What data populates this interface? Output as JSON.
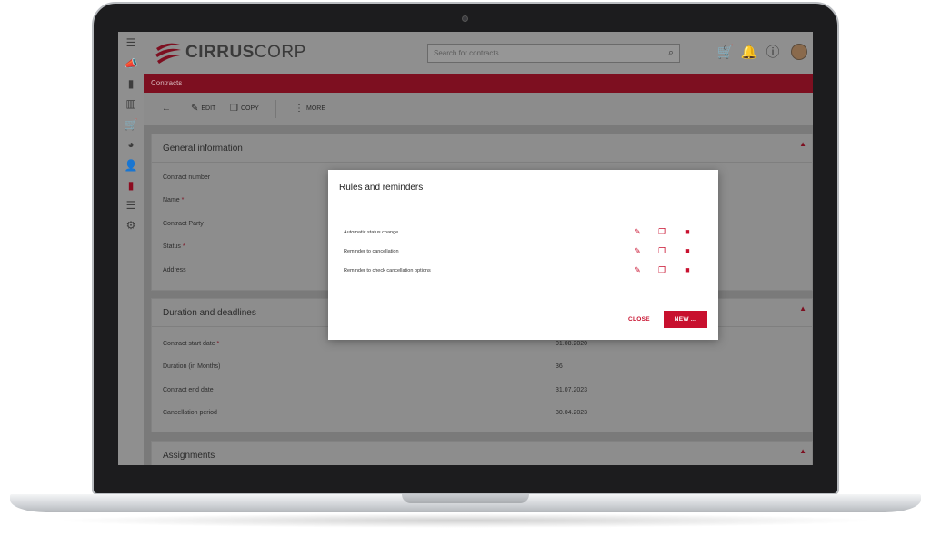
{
  "app": {
    "brand_bold": "CIRRUS",
    "brand_light": "CORP",
    "brand_color": "#c8102e"
  },
  "sidebar": {
    "items": [
      {
        "icon": "menu-icon"
      },
      {
        "icon": "megaphone-icon"
      },
      {
        "icon": "contract-doc-icon"
      },
      {
        "icon": "book-icon"
      },
      {
        "icon": "cart-icon"
      },
      {
        "icon": "pie-chart-icon"
      },
      {
        "icon": "person-icon"
      },
      {
        "icon": "contract-active-icon"
      },
      {
        "icon": "database-icon"
      },
      {
        "icon": "gear-icon"
      }
    ]
  },
  "search": {
    "placeholder": "Search for contracts..."
  },
  "header": {
    "cart_count": "0"
  },
  "breadcrumb": {
    "label": "Contracts"
  },
  "toolbar": {
    "edit_label": "EDIT",
    "copy_label": "COPY",
    "more_label": "MORE"
  },
  "general": {
    "title": "General information",
    "fields": [
      {
        "label": "Contract number",
        "required": false
      },
      {
        "label": "Name",
        "required": true
      },
      {
        "label": "Contract Party",
        "required": false
      },
      {
        "label": "Status",
        "required": true
      },
      {
        "label": "Address",
        "required": false
      }
    ]
  },
  "duration": {
    "title": "Duration and deadlines",
    "fields": [
      {
        "label": "Contract start date",
        "required": true,
        "value": "01.08.2020"
      },
      {
        "label": "Duration (in Months)",
        "required": false,
        "value": "36"
      },
      {
        "label": "Contract end date",
        "required": false,
        "value": "31.07.2023"
      },
      {
        "label": "Cancellation period",
        "required": false,
        "value": "30.04.2023"
      }
    ]
  },
  "assignments": {
    "title": "Assignments"
  },
  "modal": {
    "title": "Rules and reminders",
    "rules": [
      {
        "label": "Automatic status change"
      },
      {
        "label": "Reminder to cancellation"
      },
      {
        "label": "Reminder to check cancellation options"
      }
    ],
    "close_label": "CLOSE",
    "new_label": "NEW ..."
  },
  "required_mark": "*"
}
